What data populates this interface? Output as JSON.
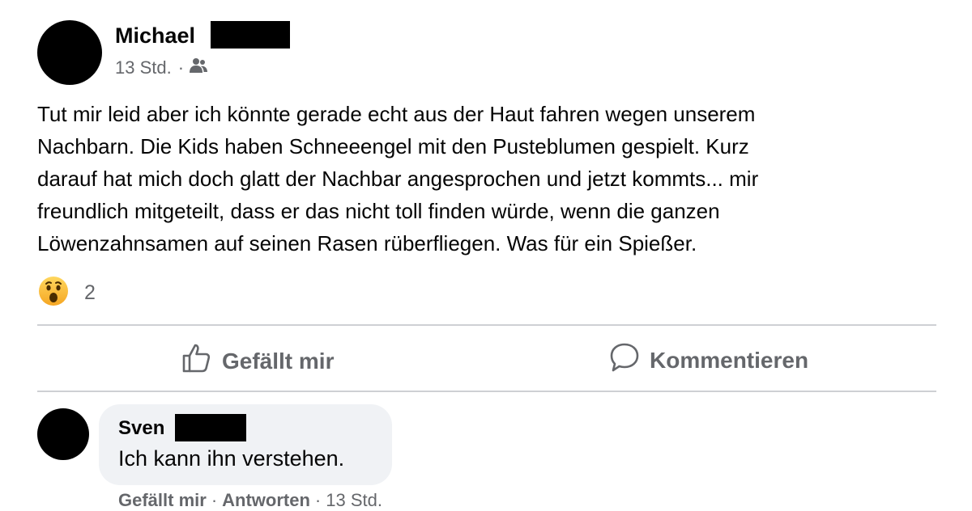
{
  "post": {
    "author_name": "Michael",
    "timestamp": "13 Std.",
    "meta_separator": "·",
    "audience_icon": "friends-icon",
    "text": "Tut mir leid aber ich könnte gerade echt aus der Haut fahren wegen unserem\nNachbarn. Die Kids haben Schneeengel mit den Pusteblumen gespielt. Kurz\ndarauf hat mich doch glatt der Nachbar angesprochen und jetzt kommts... mir\nfreundlich mitgeteilt, dass er das nicht toll finden würde, wenn die ganzen\nLöwenzahnsamen auf seinen Rasen rüberfliegen. Was für ein Spießer.",
    "reaction_icon": "wow-emoji-icon",
    "reaction_count": "2"
  },
  "actions": {
    "like_label": "Gefällt mir",
    "comment_label": "Kommentieren"
  },
  "comment": {
    "author_name": "Sven",
    "text": "Ich kann ihn verstehen.",
    "like_label": "Gefällt mir",
    "reply_label": "Antworten",
    "timestamp": "13 Std.",
    "separator": "·"
  },
  "colors": {
    "text": "#050505",
    "secondary": "#65676b",
    "divider": "#ced0d4",
    "bubble": "#f0f2f5",
    "avatar": "#000000"
  }
}
